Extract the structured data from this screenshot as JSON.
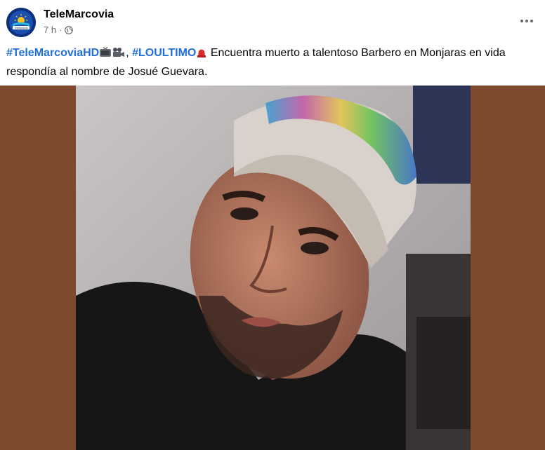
{
  "post": {
    "page_name": "TeleMarcovia",
    "avatar_logo_text": "TeleMarcovia",
    "timestamp": "7 h",
    "separator": "·",
    "privacy_icon": "globe-icon",
    "more_icon": "more-horizontal-icon",
    "text": {
      "hashtag_1": "#TeleMarcoviaHD",
      "emoji_1": "tv-icon",
      "emoji_2": "movie-camera-icon",
      "comma": ",",
      "hashtag_2": "#LOULTIMO",
      "emoji_3": "red-siren-icon",
      "body_line_1": "Encuentra muerto a talentoso Barbero en Monjaras en vida",
      "body_line_2": "respondía al nombre de Josué Guevara."
    }
  },
  "media": {
    "type": "photo",
    "description_icon": "photo-image"
  },
  "colors": {
    "link_blue": "#216fdb",
    "meta_gray": "#65676b",
    "media_background": "#7d4a2e",
    "avatar_bg": "#0a2a6e"
  }
}
